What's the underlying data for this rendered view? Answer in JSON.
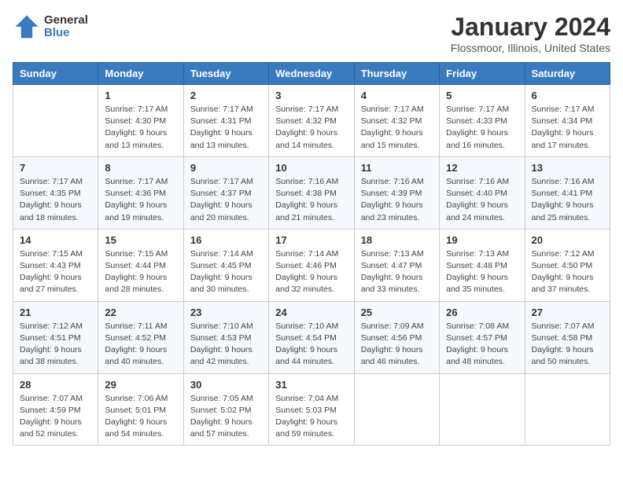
{
  "header": {
    "logo_general": "General",
    "logo_blue": "Blue",
    "title": "January 2024",
    "subtitle": "Flossmoor, Illinois, United States"
  },
  "calendar": {
    "days_of_week": [
      "Sunday",
      "Monday",
      "Tuesday",
      "Wednesday",
      "Thursday",
      "Friday",
      "Saturday"
    ],
    "weeks": [
      [
        {
          "day": "",
          "sunrise": "",
          "sunset": "",
          "daylight": ""
        },
        {
          "day": "1",
          "sunrise": "Sunrise: 7:17 AM",
          "sunset": "Sunset: 4:30 PM",
          "daylight": "Daylight: 9 hours and 13 minutes."
        },
        {
          "day": "2",
          "sunrise": "Sunrise: 7:17 AM",
          "sunset": "Sunset: 4:31 PM",
          "daylight": "Daylight: 9 hours and 13 minutes."
        },
        {
          "day": "3",
          "sunrise": "Sunrise: 7:17 AM",
          "sunset": "Sunset: 4:32 PM",
          "daylight": "Daylight: 9 hours and 14 minutes."
        },
        {
          "day": "4",
          "sunrise": "Sunrise: 7:17 AM",
          "sunset": "Sunset: 4:32 PM",
          "daylight": "Daylight: 9 hours and 15 minutes."
        },
        {
          "day": "5",
          "sunrise": "Sunrise: 7:17 AM",
          "sunset": "Sunset: 4:33 PM",
          "daylight": "Daylight: 9 hours and 16 minutes."
        },
        {
          "day": "6",
          "sunrise": "Sunrise: 7:17 AM",
          "sunset": "Sunset: 4:34 PM",
          "daylight": "Daylight: 9 hours and 17 minutes."
        }
      ],
      [
        {
          "day": "7",
          "sunrise": "Sunrise: 7:17 AM",
          "sunset": "Sunset: 4:35 PM",
          "daylight": "Daylight: 9 hours and 18 minutes."
        },
        {
          "day": "8",
          "sunrise": "Sunrise: 7:17 AM",
          "sunset": "Sunset: 4:36 PM",
          "daylight": "Daylight: 9 hours and 19 minutes."
        },
        {
          "day": "9",
          "sunrise": "Sunrise: 7:17 AM",
          "sunset": "Sunset: 4:37 PM",
          "daylight": "Daylight: 9 hours and 20 minutes."
        },
        {
          "day": "10",
          "sunrise": "Sunrise: 7:16 AM",
          "sunset": "Sunset: 4:38 PM",
          "daylight": "Daylight: 9 hours and 21 minutes."
        },
        {
          "day": "11",
          "sunrise": "Sunrise: 7:16 AM",
          "sunset": "Sunset: 4:39 PM",
          "daylight": "Daylight: 9 hours and 23 minutes."
        },
        {
          "day": "12",
          "sunrise": "Sunrise: 7:16 AM",
          "sunset": "Sunset: 4:40 PM",
          "daylight": "Daylight: 9 hours and 24 minutes."
        },
        {
          "day": "13",
          "sunrise": "Sunrise: 7:16 AM",
          "sunset": "Sunset: 4:41 PM",
          "daylight": "Daylight: 9 hours and 25 minutes."
        }
      ],
      [
        {
          "day": "14",
          "sunrise": "Sunrise: 7:15 AM",
          "sunset": "Sunset: 4:43 PM",
          "daylight": "Daylight: 9 hours and 27 minutes."
        },
        {
          "day": "15",
          "sunrise": "Sunrise: 7:15 AM",
          "sunset": "Sunset: 4:44 PM",
          "daylight": "Daylight: 9 hours and 28 minutes."
        },
        {
          "day": "16",
          "sunrise": "Sunrise: 7:14 AM",
          "sunset": "Sunset: 4:45 PM",
          "daylight": "Daylight: 9 hours and 30 minutes."
        },
        {
          "day": "17",
          "sunrise": "Sunrise: 7:14 AM",
          "sunset": "Sunset: 4:46 PM",
          "daylight": "Daylight: 9 hours and 32 minutes."
        },
        {
          "day": "18",
          "sunrise": "Sunrise: 7:13 AM",
          "sunset": "Sunset: 4:47 PM",
          "daylight": "Daylight: 9 hours and 33 minutes."
        },
        {
          "day": "19",
          "sunrise": "Sunrise: 7:13 AM",
          "sunset": "Sunset: 4:48 PM",
          "daylight": "Daylight: 9 hours and 35 minutes."
        },
        {
          "day": "20",
          "sunrise": "Sunrise: 7:12 AM",
          "sunset": "Sunset: 4:50 PM",
          "daylight": "Daylight: 9 hours and 37 minutes."
        }
      ],
      [
        {
          "day": "21",
          "sunrise": "Sunrise: 7:12 AM",
          "sunset": "Sunset: 4:51 PM",
          "daylight": "Daylight: 9 hours and 38 minutes."
        },
        {
          "day": "22",
          "sunrise": "Sunrise: 7:11 AM",
          "sunset": "Sunset: 4:52 PM",
          "daylight": "Daylight: 9 hours and 40 minutes."
        },
        {
          "day": "23",
          "sunrise": "Sunrise: 7:10 AM",
          "sunset": "Sunset: 4:53 PM",
          "daylight": "Daylight: 9 hours and 42 minutes."
        },
        {
          "day": "24",
          "sunrise": "Sunrise: 7:10 AM",
          "sunset": "Sunset: 4:54 PM",
          "daylight": "Daylight: 9 hours and 44 minutes."
        },
        {
          "day": "25",
          "sunrise": "Sunrise: 7:09 AM",
          "sunset": "Sunset: 4:56 PM",
          "daylight": "Daylight: 9 hours and 46 minutes."
        },
        {
          "day": "26",
          "sunrise": "Sunrise: 7:08 AM",
          "sunset": "Sunset: 4:57 PM",
          "daylight": "Daylight: 9 hours and 48 minutes."
        },
        {
          "day": "27",
          "sunrise": "Sunrise: 7:07 AM",
          "sunset": "Sunset: 4:58 PM",
          "daylight": "Daylight: 9 hours and 50 minutes."
        }
      ],
      [
        {
          "day": "28",
          "sunrise": "Sunrise: 7:07 AM",
          "sunset": "Sunset: 4:59 PM",
          "daylight": "Daylight: 9 hours and 52 minutes."
        },
        {
          "day": "29",
          "sunrise": "Sunrise: 7:06 AM",
          "sunset": "Sunset: 5:01 PM",
          "daylight": "Daylight: 9 hours and 54 minutes."
        },
        {
          "day": "30",
          "sunrise": "Sunrise: 7:05 AM",
          "sunset": "Sunset: 5:02 PM",
          "daylight": "Daylight: 9 hours and 57 minutes."
        },
        {
          "day": "31",
          "sunrise": "Sunrise: 7:04 AM",
          "sunset": "Sunset: 5:03 PM",
          "daylight": "Daylight: 9 hours and 59 minutes."
        },
        {
          "day": "",
          "sunrise": "",
          "sunset": "",
          "daylight": ""
        },
        {
          "day": "",
          "sunrise": "",
          "sunset": "",
          "daylight": ""
        },
        {
          "day": "",
          "sunrise": "",
          "sunset": "",
          "daylight": ""
        }
      ]
    ]
  }
}
